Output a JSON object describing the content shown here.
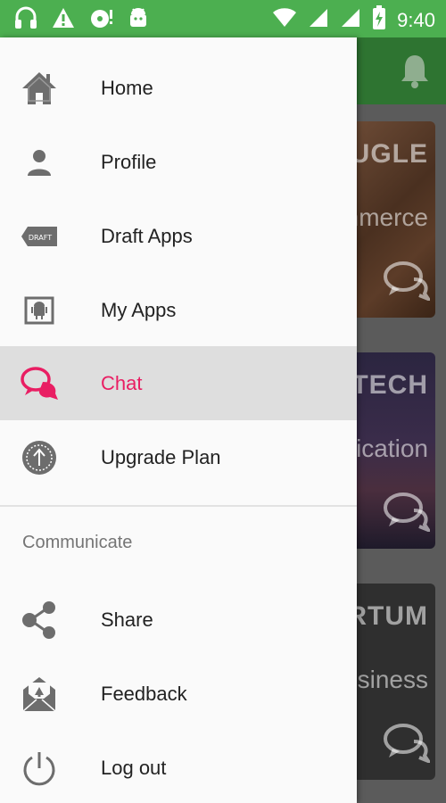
{
  "status_bar": {
    "time": "9:40",
    "icons": [
      "headphones-icon",
      "warning-icon",
      "disc-icon",
      "android-icon",
      "wifi-icon",
      "signal-icon",
      "signal-icon",
      "battery-charging-icon"
    ]
  },
  "background": {
    "cards": [
      {
        "title": "UGLE",
        "subtitle": "nmerce"
      },
      {
        "title": "TECH",
        "subtitle": "ication"
      },
      {
        "title": "RTUM",
        "subtitle": "siness"
      }
    ]
  },
  "drawer": {
    "items": [
      {
        "label": "Home",
        "icon": "home-icon"
      },
      {
        "label": "Profile",
        "icon": "person-icon"
      },
      {
        "label": "Draft Apps",
        "icon": "draft-tag-icon",
        "icon_text": "DRAFT"
      },
      {
        "label": "My Apps",
        "icon": "android-box-icon"
      },
      {
        "label": "Chat",
        "icon": "chat-icon",
        "active": true
      },
      {
        "label": "Upgrade Plan",
        "icon": "upgrade-icon"
      }
    ],
    "section_header": "Communicate",
    "communicate_items": [
      {
        "label": "Share",
        "icon": "share-icon"
      },
      {
        "label": "Feedback",
        "icon": "feedback-mail-icon"
      },
      {
        "label": "Log out",
        "icon": "power-icon"
      }
    ]
  },
  "colors": {
    "status_bar": "#4caf50",
    "toolbar": "#2e7431",
    "accent": "#e91e63",
    "icon_gray": "#6d6d6d"
  }
}
